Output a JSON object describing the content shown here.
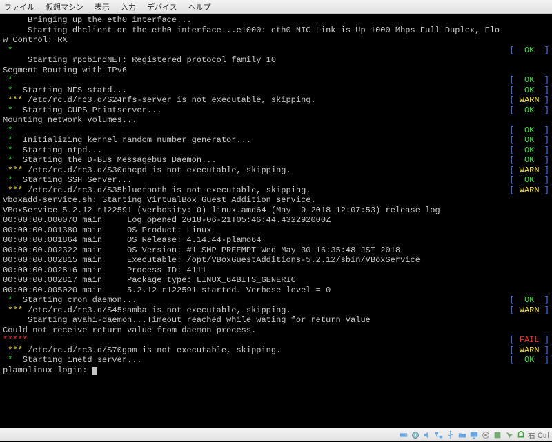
{
  "menubar": {
    "items": [
      "ファイル",
      "仮想マシン",
      "表示",
      "入力",
      "デバイス",
      "ヘルプ"
    ]
  },
  "lines": [
    {
      "bullet": null,
      "text": "     Bringing up the eth0 interface...",
      "status": null
    },
    {
      "bullet": null,
      "text": "     Starting dhclient on the eth0 interface...e1000: eth0 NIC Link is Up 1000 Mbps Full Duplex, Flo",
      "status": null
    },
    {
      "bullet": null,
      "text": "w Control: RX",
      "status": null
    },
    {
      "bullet": "*g",
      "text": "",
      "status": "OK"
    },
    {
      "bullet": null,
      "text": "     Starting rpcbindNET: Registered protocol family 10",
      "status": null
    },
    {
      "bullet": null,
      "text": "Segment Routing with IPv6",
      "status": null
    },
    {
      "bullet": "*g",
      "text": "",
      "status": "OK"
    },
    {
      "bullet": "*g",
      "text": "Starting NFS statd...",
      "status": "OK"
    },
    {
      "bullet": "*y3",
      "text": "/etc/rc.d/rc3.d/S24nfs-server is not executable, skipping.",
      "status": "WARN"
    },
    {
      "bullet": "*g",
      "text": "Starting CUPS Printserver...",
      "status": "OK"
    },
    {
      "bullet": null,
      "text": "Mounting network volumes...",
      "status": null
    },
    {
      "bullet": "*g",
      "text": "",
      "status": "OK"
    },
    {
      "bullet": "*g",
      "text": "Initializing kernel random number generator...",
      "status": "OK"
    },
    {
      "bullet": "*g",
      "text": "Starting ntpd...",
      "status": "OK"
    },
    {
      "bullet": "*g",
      "text": "Starting the D-Bus Messagebus Daemon...",
      "status": "OK"
    },
    {
      "bullet": "*y3",
      "text": "/etc/rc.d/rc3.d/S30dhcpd is not executable, skipping.",
      "status": "WARN"
    },
    {
      "bullet": "*g",
      "text": "Starting SSH Server...",
      "status": "OK"
    },
    {
      "bullet": "*y3",
      "text": "/etc/rc.d/rc3.d/S35bluetooth is not executable, skipping.",
      "status": "WARN"
    },
    {
      "bullet": null,
      "text": "vboxadd-service.sh: Starting VirtualBox Guest Addition service.",
      "status": null
    },
    {
      "bullet": null,
      "text": "VBoxService 5.2.12 r122591 (verbosity: 0) linux.amd64 (May  9 2018 12:07:53) release log",
      "status": null
    },
    {
      "bullet": null,
      "text": "00:00:00.000070 main     Log opened 2018-06-21T05:46:44.432292000Z",
      "status": null
    },
    {
      "bullet": null,
      "text": "00:00:00.001380 main     OS Product: Linux",
      "status": null
    },
    {
      "bullet": null,
      "text": "00:00:00.001864 main     OS Release: 4.14.44-plamo64",
      "status": null
    },
    {
      "bullet": null,
      "text": "00:00:00.002322 main     OS Version: #1 SMP PREEMPT Wed May 30 16:35:48 JST 2018",
      "status": null
    },
    {
      "bullet": null,
      "text": "00:00:00.002815 main     Executable: /opt/VBoxGuestAdditions-5.2.12/sbin/VBoxService",
      "status": null
    },
    {
      "bullet": null,
      "text": "00:00:00.002816 main     Process ID: 4111",
      "status": null
    },
    {
      "bullet": null,
      "text": "00:00:00.002817 main     Package type: LINUX_64BITS_GENERIC",
      "status": null
    },
    {
      "bullet": null,
      "text": "00:00:00.005020 main     5.2.12 r122591 started. Verbose level = 0",
      "status": null
    },
    {
      "bullet": "*g",
      "text": "Starting cron daemon...",
      "status": "OK"
    },
    {
      "bullet": "*y3",
      "text": "/etc/rc.d/rc3.d/S45samba is not executable, skipping.",
      "status": "WARN"
    },
    {
      "bullet": null,
      "text": "     Starting avahi-daemon...Timeout reached while wating for return value",
      "status": null
    },
    {
      "bullet": null,
      "text": "Could not receive return value from daemon process.",
      "status": null
    },
    {
      "bullet": "*r5",
      "text": "",
      "status": "FAIL"
    },
    {
      "bullet": "*y3",
      "text": "/etc/rc.d/rc3.d/S70gpm is not executable, skipping.",
      "status": "WARN"
    },
    {
      "bullet": "*g",
      "text": "Starting inetd server...",
      "status": "OK"
    },
    {
      "bullet": null,
      "text": "",
      "status": null
    },
    {
      "bullet": null,
      "text": "plamolinux login: ",
      "status": null,
      "cursor": true
    }
  ],
  "status_map": {
    "OK": {
      "label": "OK",
      "cls": "g"
    },
    "WARN": {
      "label": "WARN",
      "cls": "y"
    },
    "FAIL": {
      "label": "FAIL",
      "cls": "r"
    }
  },
  "statusbar": {
    "hostkey": "右 Ctrl"
  }
}
